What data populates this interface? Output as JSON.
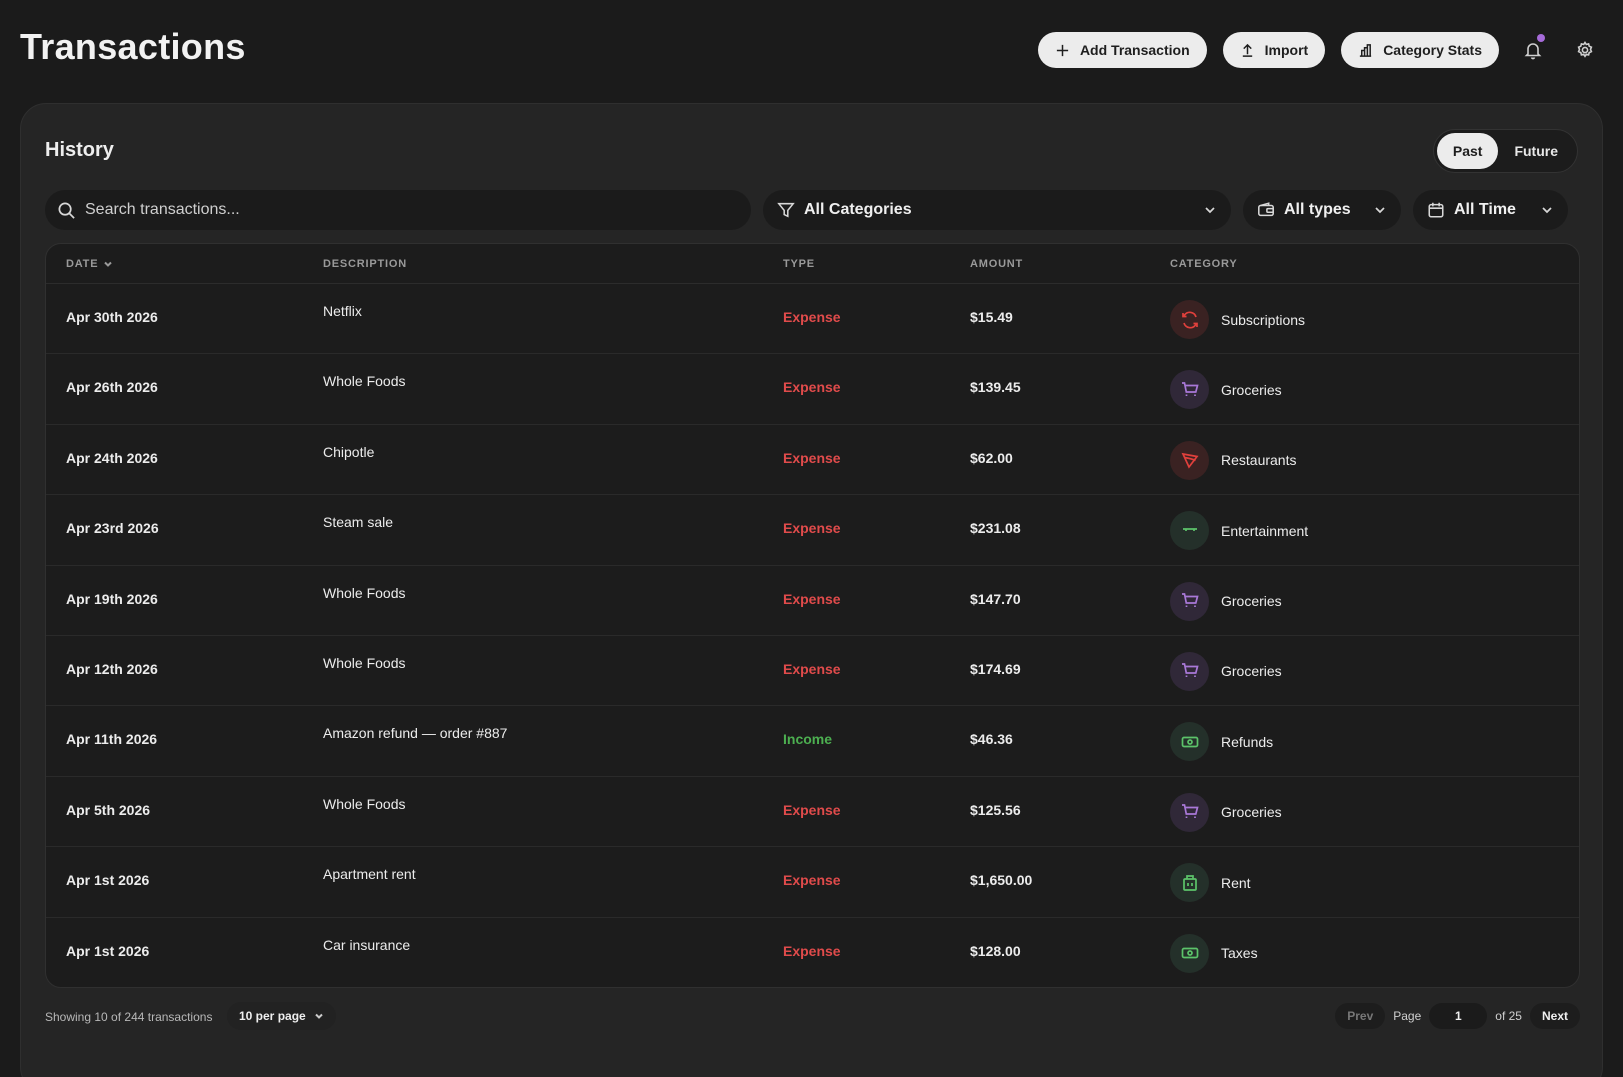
{
  "header": {
    "title": "Transactions",
    "buttons": {
      "add": "Add Transaction",
      "import": "Import",
      "stats": "Category Stats"
    }
  },
  "history": {
    "title": "History",
    "segments": {
      "past": "Past",
      "future": "Future",
      "active": "past"
    },
    "search_placeholder": "Search transactions...",
    "filters": {
      "category": "All Categories",
      "type": "All types",
      "time": "All Time"
    },
    "columns": {
      "date": "DATE",
      "description": "DESCRIPTION",
      "type": "TYPE",
      "amount": "AMOUNT",
      "category": "CATEGORY"
    },
    "rows": [
      {
        "date": "Apr 30th 2026",
        "description": "Netflix",
        "type": "Expense",
        "amount": "$15.49",
        "category": "Subscriptions",
        "icon": "refresh-icon"
      },
      {
        "date": "Apr 26th 2026",
        "description": "Whole Foods",
        "type": "Expense",
        "amount": "$139.45",
        "category": "Groceries",
        "icon": "cart-icon"
      },
      {
        "date": "Apr 24th 2026",
        "description": "Chipotle",
        "type": "Expense",
        "amount": "$62.00",
        "category": "Restaurants",
        "icon": "pizza-icon"
      },
      {
        "date": "Apr 23rd 2026",
        "description": "Steam sale",
        "type": "Expense",
        "amount": "$231.08",
        "category": "Entertainment",
        "icon": "gamepad-icon"
      },
      {
        "date": "Apr 19th 2026",
        "description": "Whole Foods",
        "type": "Expense",
        "amount": "$147.70",
        "category": "Groceries",
        "icon": "cart-icon"
      },
      {
        "date": "Apr 12th 2026",
        "description": "Whole Foods",
        "type": "Expense",
        "amount": "$174.69",
        "category": "Groceries",
        "icon": "cart-icon"
      },
      {
        "date": "Apr 11th 2026",
        "description": "Amazon refund — order #887",
        "type": "Income",
        "amount": "$46.36",
        "category": "Refunds",
        "icon": "cash-icon"
      },
      {
        "date": "Apr 5th 2026",
        "description": "Whole Foods",
        "type": "Expense",
        "amount": "$125.56",
        "category": "Groceries",
        "icon": "cart-icon"
      },
      {
        "date": "Apr 1st 2026",
        "description": "Apartment rent",
        "type": "Expense",
        "amount": "$1,650.00",
        "category": "Rent",
        "icon": "building-icon"
      },
      {
        "date": "Apr 1st 2026",
        "description": "Car insurance",
        "type": "Expense",
        "amount": "$128.00",
        "category": "Taxes",
        "icon": "cash-icon"
      }
    ],
    "footer": {
      "showing": "Showing 10 of 244 transactions",
      "per_page": "10 per page",
      "prev": "Prev",
      "page_label": "Page",
      "page_value": "1",
      "of_pages": "of 25",
      "next": "Next"
    }
  },
  "colors": {
    "background": "#1b1b1b",
    "panel": "#252525",
    "expense": "#e04b4b",
    "income": "#4caf50",
    "notification_dot": "#a66bd9"
  }
}
